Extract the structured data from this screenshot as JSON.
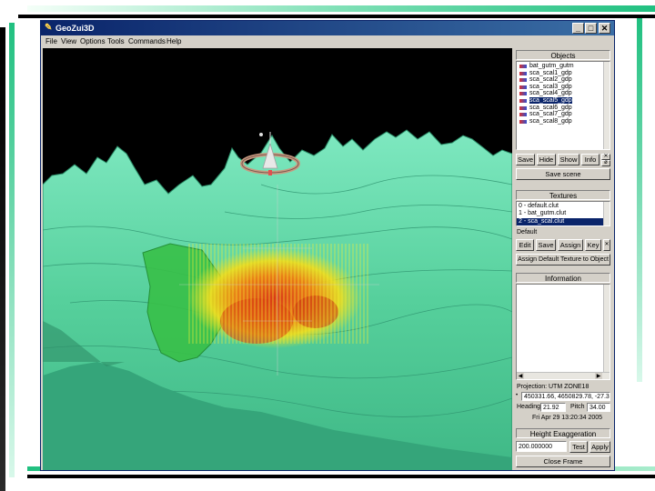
{
  "window": {
    "title": "GeoZui3D"
  },
  "menu": [
    "File",
    "View",
    "Options",
    "Tools",
    "Commands",
    "Help"
  ],
  "objects": {
    "title": "Objects",
    "items": [
      {
        "label": "bat_gutm_gutm",
        "selected": false
      },
      {
        "label": "sca_scal1_gdp",
        "selected": false
      },
      {
        "label": "sca_scal2_gdp",
        "selected": false
      },
      {
        "label": "sca_scal3_gdp",
        "selected": false
      },
      {
        "label": "sca_scal4_gdp",
        "selected": false
      },
      {
        "label": "sca_scal5_gdp",
        "selected": true
      },
      {
        "label": "sca_scal6_gdp",
        "selected": false
      },
      {
        "label": "sca_scal7_gdp",
        "selected": false
      },
      {
        "label": "sca_scal8_gdp",
        "selected": false
      }
    ],
    "buttons": {
      "save": "Save",
      "hide": "Hide",
      "show": "Show",
      "info": "Info"
    },
    "save_scene": "Save scene"
  },
  "textures": {
    "title": "Textures",
    "items": [
      {
        "label": "0 - default.clut",
        "selected": false
      },
      {
        "label": "1 - bat_gutm.clut",
        "selected": false
      },
      {
        "label": "2 - sca_scal.clut",
        "selected": true
      }
    ],
    "default_label": "Default",
    "buttons": {
      "edit": "Edit",
      "save": "Save",
      "assign": "Assign",
      "key": "Key"
    },
    "assign_default": "Assign Default Texture to Object"
  },
  "information": {
    "title": "Information",
    "projection_label": "Projection:",
    "projection_value": "UTM ZONE18",
    "coords": "450331.66, 4650829.78, -27.33",
    "heading_label": "Heading",
    "heading_value": "21.92",
    "pitch_label": "Pitch",
    "pitch_value": "34.00",
    "datetime": "Fri Apr 29 13:20:34 2005"
  },
  "height_exaggeration": {
    "title": "Height Exaggeration",
    "value": "200.000000",
    "test": "Test",
    "apply": "Apply"
  },
  "close_frame": "Close Frame",
  "colors": {
    "terrain": "#5fd6a4",
    "terrain_dark": "#1f6c4f",
    "titlebar": "#0a246a",
    "selection": "#0a246a"
  }
}
